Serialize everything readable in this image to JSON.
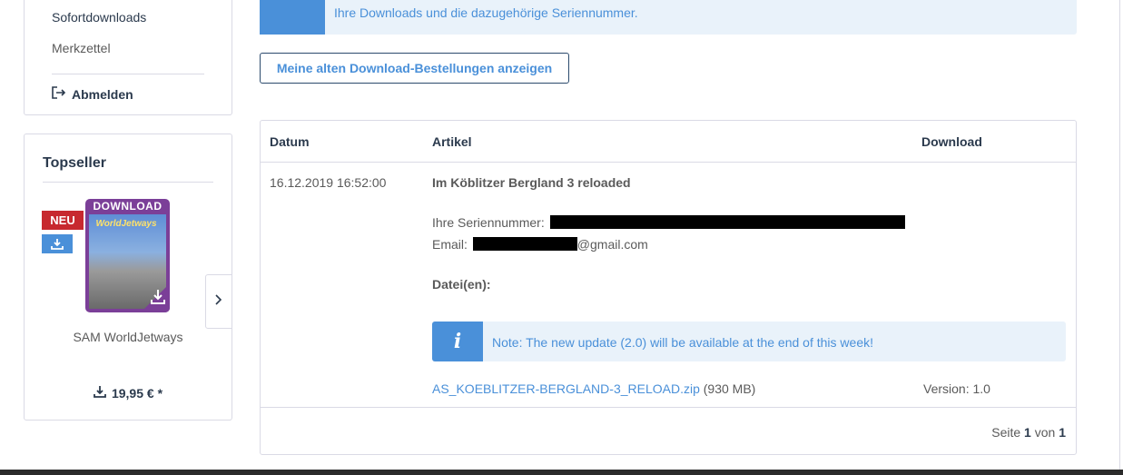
{
  "sidebar": {
    "nav_active": "Sofortdownloads",
    "nav_merkzettel": "Merkzettel",
    "logout": "Abmelden"
  },
  "topseller": {
    "title": "Topseller",
    "badge_new": "NEU",
    "cover_header": "DOWNLOAD",
    "cover_name": "WorldJetways",
    "product_name": "SAM WorldJetways",
    "price": "19,95 € *"
  },
  "alert_top": {
    "text": "Ihre Downloads und die dazugehörige Seriennummer."
  },
  "buttons": {
    "old_orders": "Meine alten Download-Bestellungen anzeigen"
  },
  "table": {
    "headers": {
      "date": "Datum",
      "article": "Artikel",
      "download": "Download"
    },
    "row": {
      "date": "16.12.2019 16:52:00",
      "article": "Im Köblitzer Bergland 3 reloaded",
      "serial_label": "Ihre Seriennummer:",
      "email_label": "Email:",
      "email_suffix": "@gmail.com",
      "files_label": "Datei(en):",
      "note": "Note: The new update (2.0) will be available at the end of this week!",
      "note_icon": "i",
      "file_name": "AS_KOEBLITZER-BERGLAND-3_RELOAD.zip",
      "file_size": "(930 MB)",
      "version": "Version: 1.0"
    },
    "pager": {
      "prefix": "Seite",
      "current": "1",
      "sep": "von",
      "total": "1"
    }
  },
  "colors": {
    "accent": "#4a90d9",
    "dark": "#2b3a4d",
    "badge_new": "#c7292f",
    "cover_purple": "#7b3f98"
  }
}
